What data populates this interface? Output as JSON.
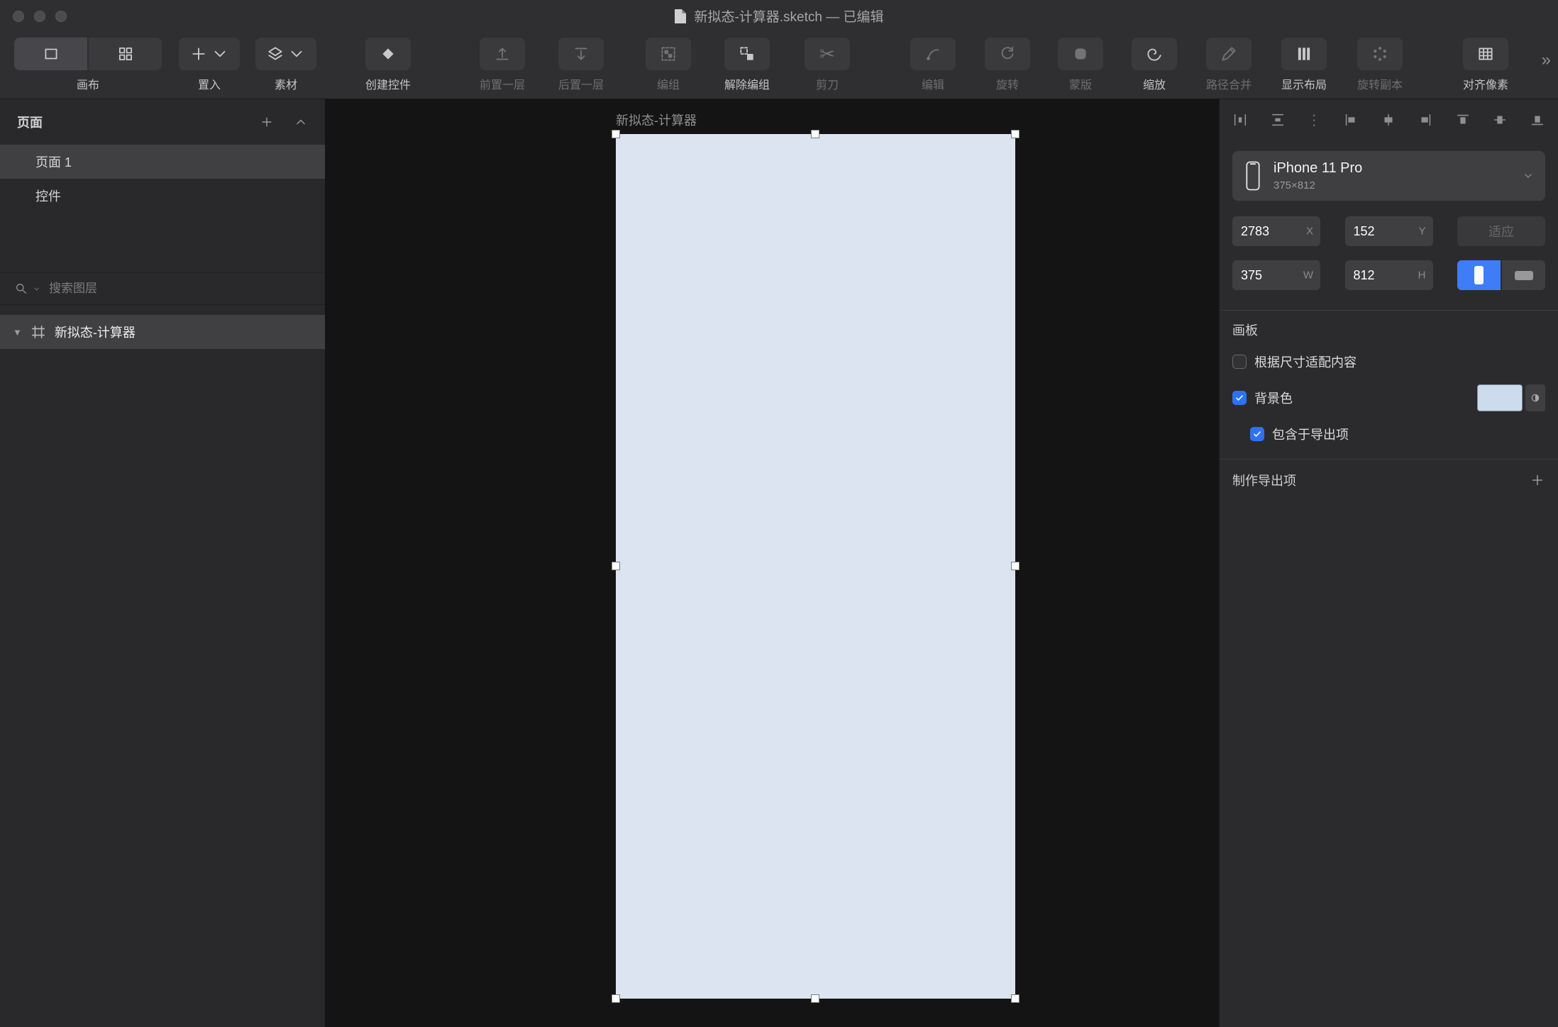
{
  "titlebar": {
    "title": "新拟态-计算器.sketch — 已编辑"
  },
  "toolbar": {
    "items": [
      {
        "id": "canvas",
        "label": "画布",
        "type": "segmented",
        "icons": [
          "artboard-icon",
          "grid-icon"
        ],
        "enabled": true,
        "ml": 0
      },
      {
        "id": "insert",
        "label": "置入",
        "icon": "plus-icon",
        "chevron": true,
        "enabled": true,
        "ml": 17
      },
      {
        "id": "assets",
        "label": "素材",
        "icon": "layers-icon",
        "chevron": true,
        "enabled": true,
        "ml": 8
      },
      {
        "id": "create-symbol",
        "label": "创建控件",
        "icon": "diamond-icon",
        "enabled": true,
        "ml": 44
      },
      {
        "id": "bring-forward",
        "label": "前置一层",
        "icon": "bring-forward-icon",
        "enabled": false,
        "ml": 61
      },
      {
        "id": "send-backward",
        "label": "后置一层",
        "icon": "send-backward-icon",
        "enabled": false,
        "ml": 11
      },
      {
        "id": "group",
        "label": "编组",
        "icon": "group-icon",
        "enabled": false,
        "ml": 23
      },
      {
        "id": "ungroup",
        "label": "解除编组",
        "icon": "ungroup-icon",
        "enabled": true,
        "ml": 11
      },
      {
        "id": "scissors",
        "label": "剪刀",
        "icon": "scissors-icon",
        "enabled": false,
        "ml": 13
      },
      {
        "id": "edit",
        "label": "编辑",
        "icon": "edit-vector-icon",
        "enabled": false,
        "ml": 49
      },
      {
        "id": "rotate",
        "label": "旋转",
        "icon": "rotate-icon",
        "enabled": false,
        "ml": 5
      },
      {
        "id": "mask",
        "label": "蒙版",
        "icon": "mask-icon",
        "enabled": false,
        "ml": 3
      },
      {
        "id": "scale",
        "label": "缩放",
        "icon": "scale-icon",
        "enabled": true,
        "ml": 4
      },
      {
        "id": "path-merge",
        "label": "路径合并",
        "icon": "path-merge-icon",
        "enabled": false,
        "ml": 5
      },
      {
        "id": "show-layout",
        "label": "显示布局",
        "icon": "layout-icon",
        "enabled": true,
        "ml": 6
      },
      {
        "id": "rotate-copies",
        "label": "旋转副本",
        "icon": "rotate-copies-icon",
        "enabled": false,
        "ml": 7
      },
      {
        "id": "pixel-align",
        "label": "对齐像素",
        "icon": "pixel-align-icon",
        "enabled": true,
        "ml": 49
      }
    ],
    "overflow": "»"
  },
  "sidebar": {
    "pages_title": "页面",
    "pages": [
      {
        "label": "页面 1",
        "selected": true
      },
      {
        "label": "控件",
        "selected": false
      }
    ],
    "search_placeholder": "搜索图层",
    "layer": {
      "label": "新拟态-计算器",
      "selected": true
    }
  },
  "canvas": {
    "artboard_label": "新拟态-计算器",
    "artboard_fill": "#dbe4f0"
  },
  "inspector": {
    "device": {
      "name": "iPhone 11 Pro",
      "size": "375×812"
    },
    "position": {
      "x": "2783",
      "x_unit": "X",
      "y": "152",
      "y_unit": "Y",
      "fit_label": "适应"
    },
    "size": {
      "w": "375",
      "w_unit": "W",
      "h": "812",
      "h_unit": "H"
    },
    "artboard_panel": {
      "title": "画板",
      "resize_content_label": "根据尺寸适配内容",
      "resize_content_checked": false,
      "background_label": "背景色",
      "background_checked": true,
      "background_color": "#ccdcee",
      "include_export_label": "包含于导出项",
      "include_export_checked": true
    },
    "export_panel": {
      "title": "制作导出项"
    }
  },
  "colors": {
    "accent": "#2f71f5",
    "artboard": "#dbe4f0"
  }
}
